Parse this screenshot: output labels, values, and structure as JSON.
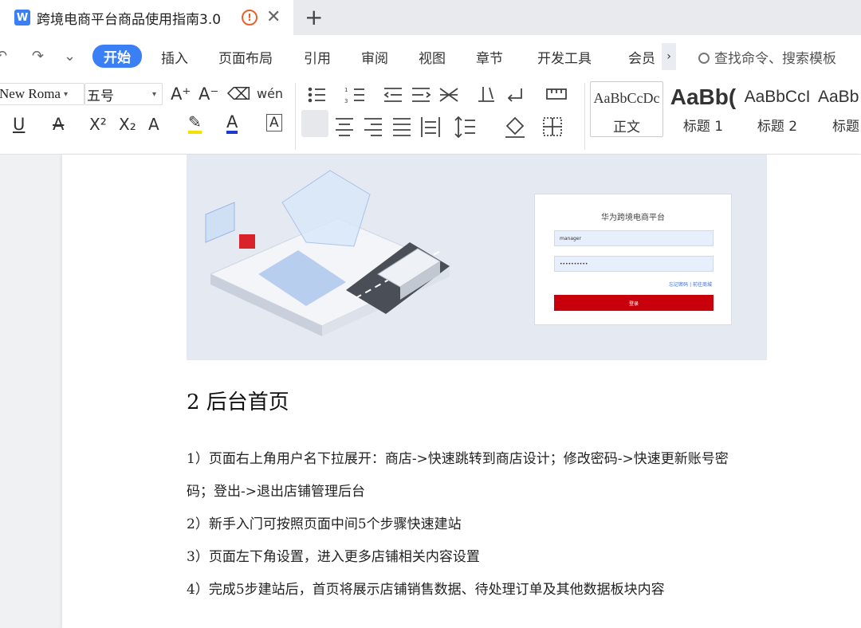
{
  "tab": {
    "app_icon": "W",
    "title": "跨境电商平台商品使用指南3.0",
    "warning_icon": "!",
    "close_icon": "✕",
    "new_tab_icon": "+"
  },
  "menubar": {
    "undo_icon": "↶",
    "redo_icon": "↷",
    "qa_dropdown_icon": "⌄",
    "items": [
      "开始",
      "插入",
      "页面布局",
      "引用",
      "审阅",
      "视图",
      "章节",
      "开发工具",
      "会员"
    ],
    "active": "开始",
    "more_icon": "›",
    "search_icon": "🔍",
    "search_placeholder": "查找命令、搜索模板"
  },
  "ribbon": {
    "font_name": "New Roma",
    "font_size": "五号",
    "increase_font": "A⁺",
    "decrease_font": "A⁻",
    "clear_format": "⌫",
    "pinyin": "wén",
    "underline": "U",
    "strikethrough": "A",
    "superscript": "X²",
    "subscript": "X₂",
    "text_effect": "A",
    "highlight": "✎",
    "font_color": "A",
    "char_border": "A",
    "styles": [
      {
        "sample": "AaBbCcDc",
        "name": "正文"
      },
      {
        "sample": "AaBb(",
        "name": "标题 1"
      },
      {
        "sample": "AaBbCcI",
        "name": "标题 2"
      },
      {
        "sample": "AaBb",
        "name": "标题"
      }
    ],
    "colors": {
      "highlight": "#f5e000",
      "font": "#1a3bd0"
    }
  },
  "document": {
    "login_card": {
      "title": "华为跨境电商平台",
      "username": "manager",
      "password": "••••••••••",
      "links": "忘记密码 | 前往商城",
      "button": "登录"
    },
    "heading": "2   后台首页",
    "paragraphs": [
      "1）页面右上角用户名下拉展开：商店->快速跳转到商店设计；修改密码->快速更新账号密",
      "码；登出->退出店铺管理后台",
      "2）新手入门可按照页面中间5个步骤快速建站",
      "3）页面左下角设置，进入更多店铺相关内容设置",
      "4）完成5步建站后，首页将展示店铺销售数据、待处理订单及其他数据板块内容"
    ]
  }
}
